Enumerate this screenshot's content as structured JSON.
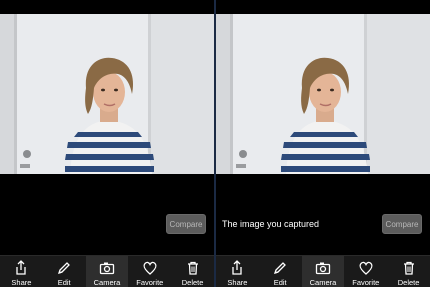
{
  "left_panel": {
    "compare_label": "Compare",
    "toolbar": [
      {
        "label": "Share",
        "icon": "share-icon"
      },
      {
        "label": "Edit",
        "icon": "pencil-icon"
      },
      {
        "label": "Camera",
        "icon": "camera-icon"
      },
      {
        "label": "Favorite",
        "icon": "heart-icon"
      },
      {
        "label": "Delete",
        "icon": "trash-icon"
      }
    ]
  },
  "right_panel": {
    "caption": "The image you captured",
    "compare_label": "Compare",
    "toolbar": [
      {
        "label": "Share",
        "icon": "share-icon"
      },
      {
        "label": "Edit",
        "icon": "pencil-icon"
      },
      {
        "label": "Camera",
        "icon": "camera-icon"
      },
      {
        "label": "Favorite",
        "icon": "heart-icon"
      },
      {
        "label": "Delete",
        "icon": "trash-icon"
      }
    ]
  },
  "colors": {
    "background": "#000000",
    "toolbar": "#1a1a1a",
    "compare_button": "#5c5c5c",
    "divider": "#1b2a44"
  }
}
